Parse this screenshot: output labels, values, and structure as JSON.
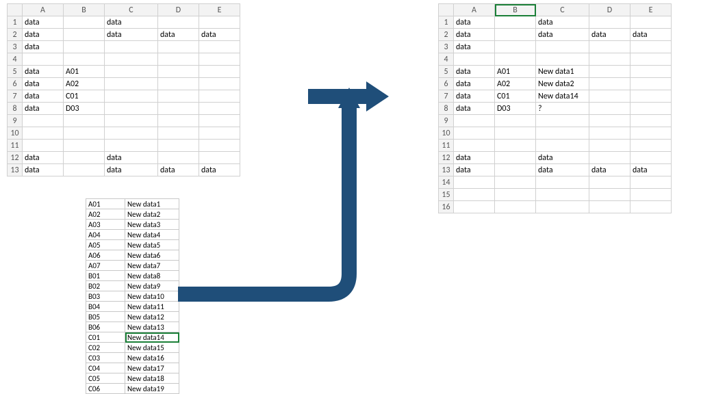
{
  "columns": [
    "A",
    "B",
    "C",
    "D",
    "E"
  ],
  "left": {
    "rows": [
      {
        "n": "1",
        "c": [
          "data",
          "",
          "data",
          "",
          ""
        ]
      },
      {
        "n": "2",
        "c": [
          "data",
          "",
          "data",
          "data",
          "data"
        ]
      },
      {
        "n": "3",
        "c": [
          "data",
          "",
          "",
          "",
          ""
        ]
      },
      {
        "n": "4",
        "c": [
          "",
          "",
          "",
          "",
          ""
        ]
      },
      {
        "n": "5",
        "c": [
          "data",
          "A01",
          "",
          "",
          ""
        ]
      },
      {
        "n": "6",
        "c": [
          "data",
          "A02",
          "",
          "",
          ""
        ]
      },
      {
        "n": "7",
        "c": [
          "data",
          "C01",
          "",
          "",
          ""
        ]
      },
      {
        "n": "8",
        "c": [
          "data",
          "D03",
          "",
          "",
          ""
        ]
      },
      {
        "n": "9",
        "c": [
          "",
          "",
          "",
          "",
          ""
        ]
      },
      {
        "n": "10",
        "c": [
          "",
          "",
          "",
          "",
          ""
        ]
      },
      {
        "n": "11",
        "c": [
          "",
          "",
          "",
          "",
          ""
        ]
      },
      {
        "n": "12",
        "c": [
          "data",
          "",
          "data",
          "",
          ""
        ]
      },
      {
        "n": "13",
        "c": [
          "data",
          "",
          "data",
          "data",
          "data"
        ]
      }
    ]
  },
  "right": {
    "rows": [
      {
        "n": "1",
        "c": [
          "data",
          "",
          "data",
          "",
          ""
        ]
      },
      {
        "n": "2",
        "c": [
          "data",
          "",
          "data",
          "data",
          "data"
        ]
      },
      {
        "n": "3",
        "c": [
          "data",
          "",
          "",
          "",
          ""
        ]
      },
      {
        "n": "4",
        "c": [
          "",
          "",
          "",
          "",
          ""
        ]
      },
      {
        "n": "5",
        "c": [
          "data",
          "A01",
          "New data1",
          "",
          ""
        ]
      },
      {
        "n": "6",
        "c": [
          "data",
          "A02",
          "New data2",
          "",
          ""
        ]
      },
      {
        "n": "7",
        "c": [
          "data",
          "C01",
          "New data14",
          "",
          ""
        ]
      },
      {
        "n": "8",
        "c": [
          "data",
          "D03",
          "?",
          "",
          ""
        ]
      },
      {
        "n": "9",
        "c": [
          "",
          "",
          "",
          "",
          ""
        ]
      },
      {
        "n": "10",
        "c": [
          "",
          "",
          "",
          "",
          ""
        ]
      },
      {
        "n": "11",
        "c": [
          "",
          "",
          "",
          "",
          ""
        ]
      },
      {
        "n": "12",
        "c": [
          "data",
          "",
          "data",
          "",
          ""
        ]
      },
      {
        "n": "13",
        "c": [
          "data",
          "",
          "data",
          "data",
          "data"
        ]
      },
      {
        "n": "14",
        "c": [
          "",
          "",
          "",
          "",
          ""
        ]
      },
      {
        "n": "15",
        "c": [
          "",
          "",
          "",
          "",
          ""
        ]
      },
      {
        "n": "16",
        "c": [
          "",
          "",
          "",
          "",
          ""
        ]
      }
    ]
  },
  "lookup": [
    [
      "A01",
      "New data1"
    ],
    [
      "A02",
      "New data2"
    ],
    [
      "A03",
      "New data3"
    ],
    [
      "A04",
      "New data4"
    ],
    [
      "A05",
      "New data5"
    ],
    [
      "A06",
      "New data6"
    ],
    [
      "A07",
      "New data7"
    ],
    [
      "B01",
      "New data8"
    ],
    [
      "B02",
      "New data9"
    ],
    [
      "B03",
      "New data10"
    ],
    [
      "B04",
      "New data11"
    ],
    [
      "B05",
      "New data12"
    ],
    [
      "B06",
      "New data13"
    ],
    [
      "C01",
      "New data14"
    ],
    [
      "C02",
      "New data15"
    ],
    [
      "C03",
      "New data16"
    ],
    [
      "C04",
      "New data17"
    ],
    [
      "C05",
      "New data18"
    ],
    [
      "C06",
      "New data19"
    ]
  ],
  "lookup_selected_index": 13,
  "arrow_color": "#1f4e79"
}
